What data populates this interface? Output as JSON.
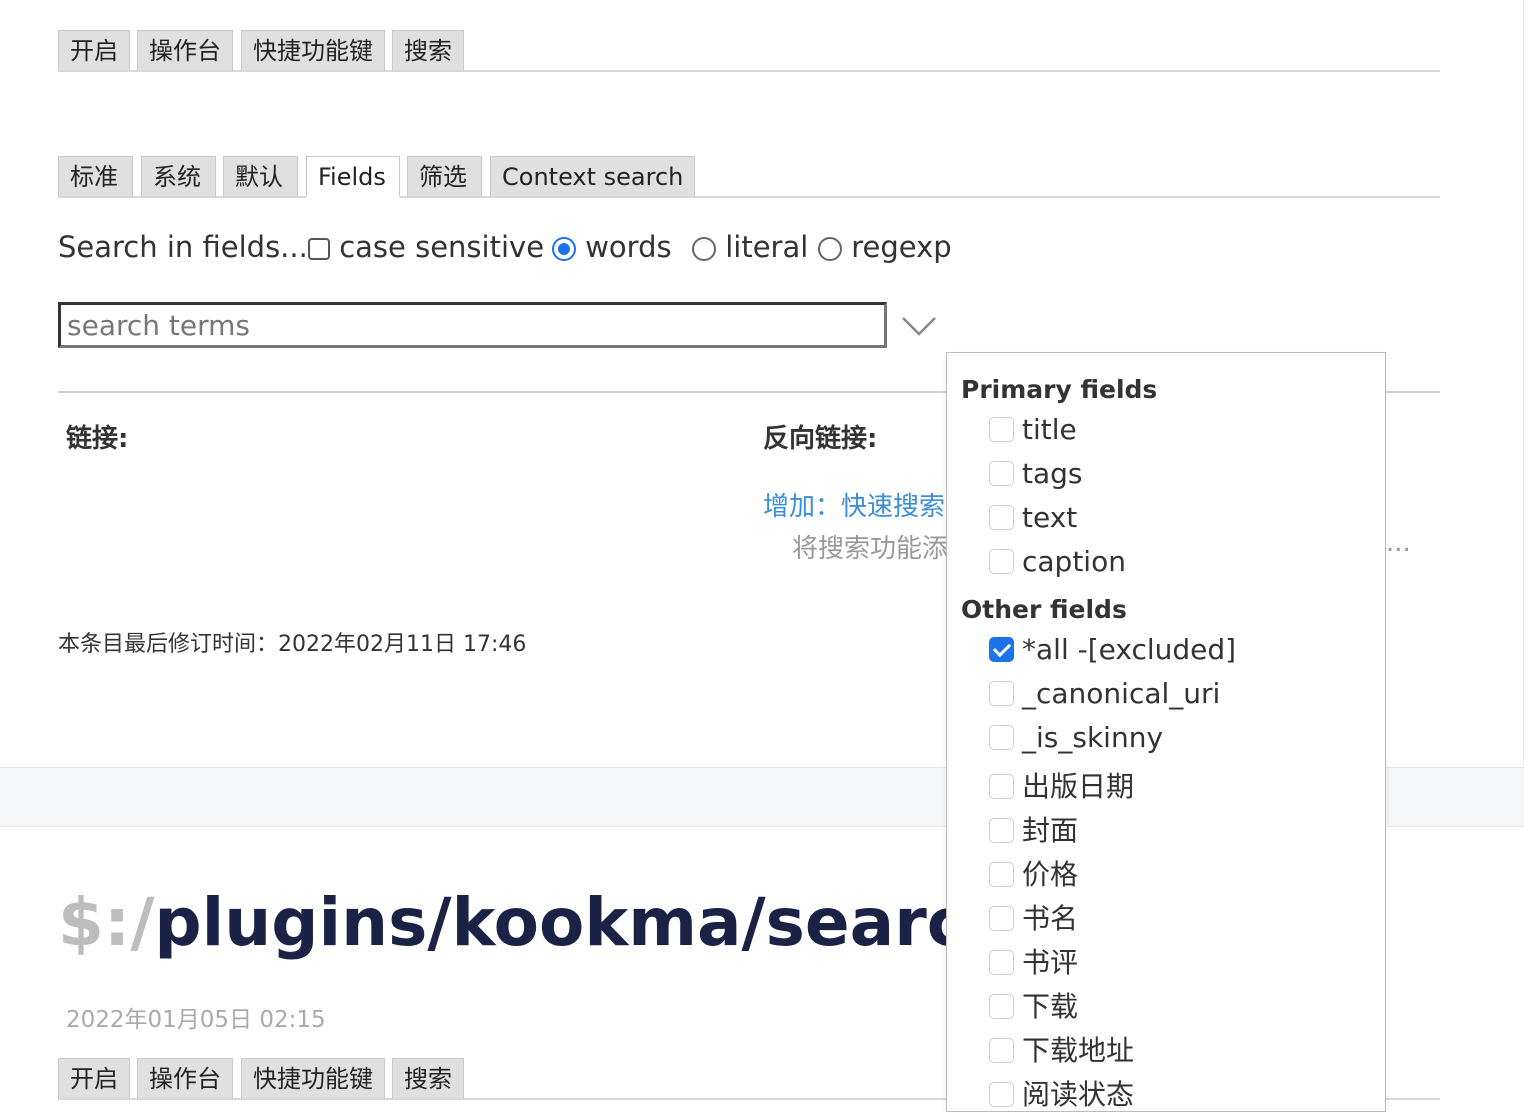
{
  "tabs_top": [
    "开启",
    "操作台",
    "快捷功能键",
    "搜索"
  ],
  "tabs_search": [
    "标准",
    "系统",
    "默认",
    "Fields",
    "筛选",
    "Context search"
  ],
  "active_search_tab": "Fields",
  "options": {
    "lead": "Search in fields...",
    "case_sensitive": "case sensitive",
    "words": "words",
    "literal": "literal",
    "regexp": "regexp"
  },
  "search": {
    "placeholder": "search terms"
  },
  "links": {
    "links_label": "链接:",
    "backlinks_label": "反向链接:",
    "backlink_title": "增加：快速搜索",
    "backlink_desc": "将搜索功能添",
    "ellipsis": "..."
  },
  "modified": "本条目最后修订时间：2022年02月11日 17:46",
  "next_tiddler": {
    "title_prefix": "$:/",
    "title_rest": "plugins/kookma/search",
    "created": "2022年01月05日 02:15",
    "tabs": [
      "开启",
      "操作台",
      "快捷功能键",
      "搜索"
    ]
  },
  "popup": {
    "primary_label": "Primary fields",
    "primary": [
      "title",
      "tags",
      "text",
      "caption"
    ],
    "other_label": "Other fields",
    "other": [
      "*all -[excluded]",
      "_canonical_uri",
      "_is_skinny",
      "出版日期",
      "封面",
      "价格",
      "书名",
      "书评",
      "下载",
      "下载地址",
      "阅读状态"
    ],
    "checked": "*all -[excluded]"
  },
  "colors": {
    "accent": "#1a73e8",
    "link": "#3a8fd8",
    "title": "#1a2345"
  }
}
